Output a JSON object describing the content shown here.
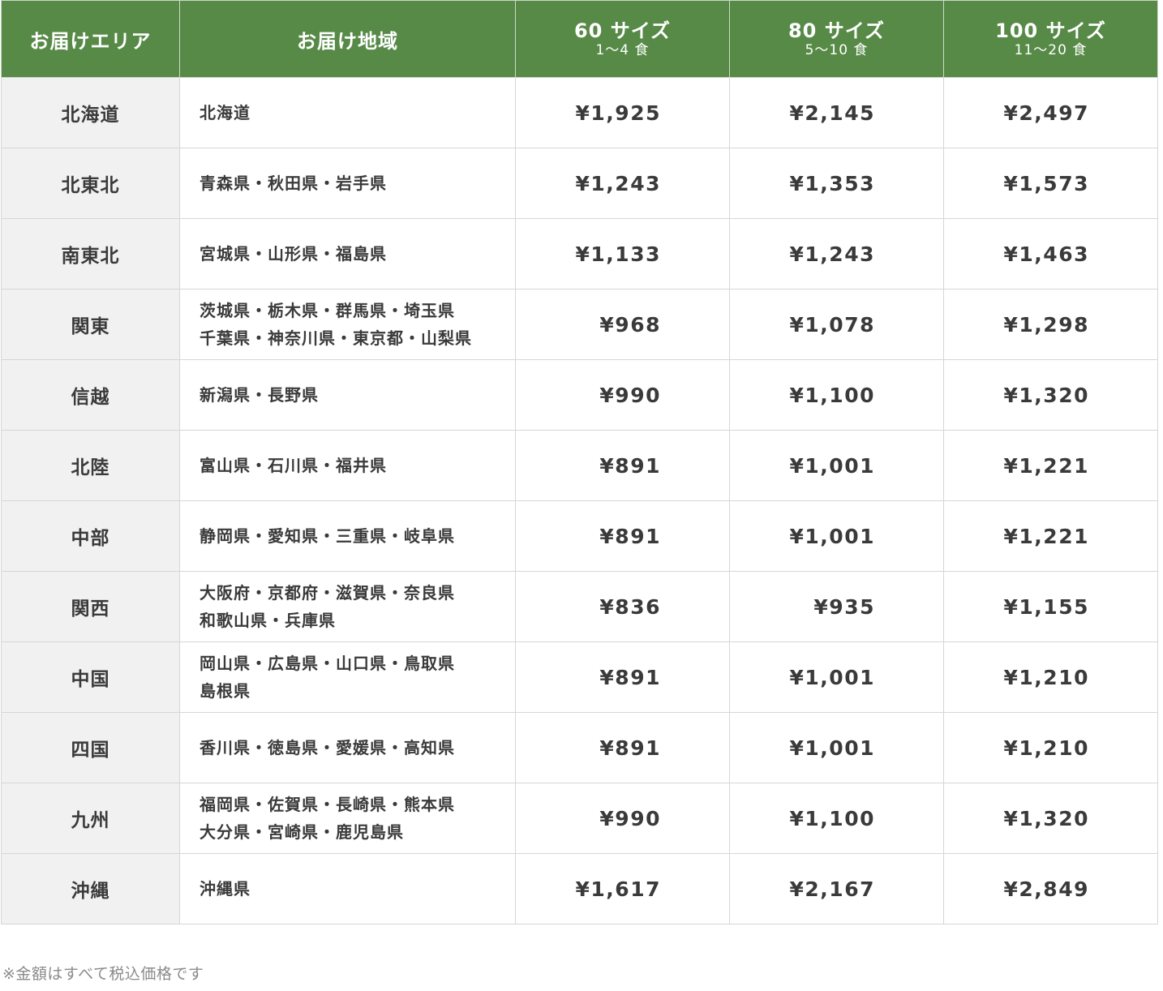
{
  "table": {
    "headers": {
      "area": "お届けエリア",
      "region": "お届け地域",
      "size60": {
        "label": "60 サイズ",
        "sub": "1～4 食"
      },
      "size80": {
        "label": "80 サイズ",
        "sub": "5～10 食"
      },
      "size100": {
        "label": "100 サイズ",
        "sub": "11～20 食"
      }
    },
    "rows": [
      {
        "area": "北海道",
        "regions": [
          "北海道"
        ],
        "p60": "¥1,925",
        "p80": "¥2,145",
        "p100": "¥2,497"
      },
      {
        "area": "北東北",
        "regions": [
          "青森県・秋田県・岩手県"
        ],
        "p60": "¥1,243",
        "p80": "¥1,353",
        "p100": "¥1,573"
      },
      {
        "area": "南東北",
        "regions": [
          "宮城県・山形県・福島県"
        ],
        "p60": "¥1,133",
        "p80": "¥1,243",
        "p100": "¥1,463"
      },
      {
        "area": "関東",
        "regions": [
          "茨城県・栃木県・群馬県・埼玉県",
          "千葉県・神奈川県・東京都・山梨県"
        ],
        "p60": "¥968",
        "p80": "¥1,078",
        "p100": "¥1,298"
      },
      {
        "area": "信越",
        "regions": [
          "新潟県・長野県"
        ],
        "p60": "¥990",
        "p80": "¥1,100",
        "p100": "¥1,320"
      },
      {
        "area": "北陸",
        "regions": [
          "富山県・石川県・福井県"
        ],
        "p60": "¥891",
        "p80": "¥1,001",
        "p100": "¥1,221"
      },
      {
        "area": "中部",
        "regions": [
          "静岡県・愛知県・三重県・岐阜県"
        ],
        "p60": "¥891",
        "p80": "¥1,001",
        "p100": "¥1,221"
      },
      {
        "area": "関西",
        "regions": [
          "大阪府・京都府・滋賀県・奈良県",
          "和歌山県・兵庫県"
        ],
        "p60": "¥836",
        "p80": "¥935",
        "p100": "¥1,155"
      },
      {
        "area": "中国",
        "regions": [
          "岡山県・広島県・山口県・鳥取県",
          "島根県"
        ],
        "p60": "¥891",
        "p80": "¥1,001",
        "p100": "¥1,210"
      },
      {
        "area": "四国",
        "regions": [
          "香川県・徳島県・愛媛県・高知県"
        ],
        "p60": "¥891",
        "p80": "¥1,001",
        "p100": "¥1,210"
      },
      {
        "area": "九州",
        "regions": [
          "福岡県・佐賀県・長崎県・熊本県",
          "大分県・宮崎県・鹿児島県"
        ],
        "p60": "¥990",
        "p80": "¥1,100",
        "p100": "¥1,320"
      },
      {
        "area": "沖縄",
        "regions": [
          "沖縄県"
        ],
        "p60": "¥1,617",
        "p80": "¥2,167",
        "p100": "¥2,849"
      }
    ]
  },
  "footnote": "※金額はすべて税込価格です"
}
